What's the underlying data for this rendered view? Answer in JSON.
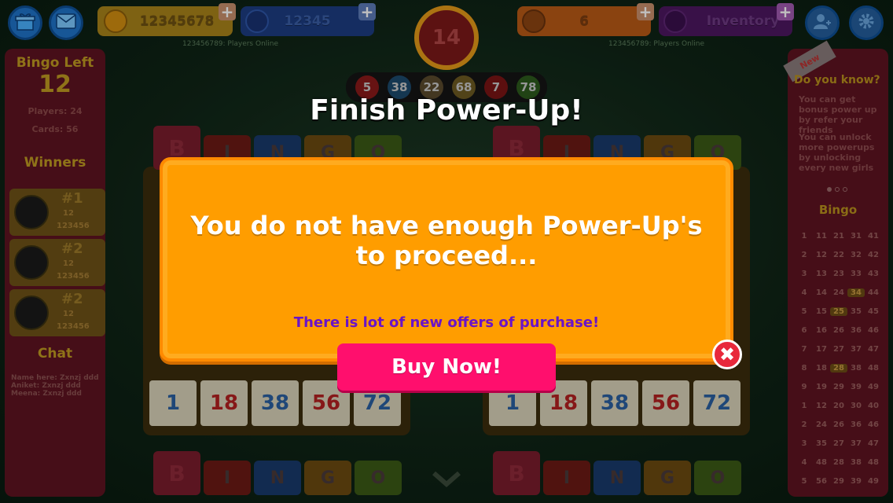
{
  "topbar": {
    "coins": "12345678",
    "energy": "12345",
    "left_online": "123456789: Players Online",
    "timer": "14",
    "powerups": "6",
    "inventory_label": "Inventory",
    "right_online": "123456789: Players Online",
    "plus_symbol": "+"
  },
  "called_balls": [
    {
      "value": "5",
      "color": "#8a1a1a"
    },
    {
      "value": "38",
      "color": "#1c4a6d"
    },
    {
      "value": "22",
      "color": "#5a4a2d"
    },
    {
      "value": "68",
      "color": "#6d5a22"
    },
    {
      "value": "7",
      "color": "#7a1515"
    },
    {
      "value": "78",
      "color": "#2d5a1c"
    }
  ],
  "left_panel": {
    "bingo_left_label": "Bingo Left",
    "bingo_left_value": "12",
    "players": "Players: 24",
    "cards": "Cards: 56",
    "winners_label": "Winners",
    "winners": [
      {
        "rank": "#1",
        "score": "12",
        "coins": "123456"
      },
      {
        "rank": "#2",
        "score": "12",
        "coins": "123456"
      },
      {
        "rank": "#2",
        "score": "12",
        "coins": "123456"
      }
    ],
    "chat_label": "Chat",
    "chat_lines": [
      "Name here: Zxnzj ddd",
      "Aniket: Zxnzj ddd",
      "Meena: Zxnzj ddd"
    ]
  },
  "right_panel": {
    "new_badge": "New",
    "did_you_know": "Do you know?",
    "tips": [
      "You can get bonus power up by refer your friends",
      "You can unlock more powerups by unlocking every new girls"
    ],
    "bingo_label": "Bingo",
    "grid": [
      [
        "1",
        "11",
        "21",
        "31",
        "41"
      ],
      [
        "2",
        "12",
        "22",
        "32",
        "42"
      ],
      [
        "3",
        "13",
        "23",
        "33",
        "43"
      ],
      [
        "4",
        "14",
        "24",
        "34",
        "44"
      ],
      [
        "5",
        "15",
        "25",
        "35",
        "45"
      ],
      [
        "6",
        "16",
        "26",
        "36",
        "46"
      ],
      [
        "7",
        "17",
        "27",
        "37",
        "47"
      ],
      [
        "8",
        "18",
        "28",
        "38",
        "48"
      ],
      [
        "9",
        "19",
        "29",
        "39",
        "49"
      ],
      [
        "1",
        "12",
        "20",
        "30",
        "40"
      ],
      [
        "2",
        "24",
        "26",
        "36",
        "46"
      ],
      [
        "3",
        "35",
        "27",
        "37",
        "47"
      ],
      [
        "4",
        "48",
        "28",
        "38",
        "48"
      ],
      [
        "5",
        "56",
        "29",
        "39",
        "49"
      ]
    ],
    "highlighted": [
      [
        3,
        3
      ],
      [
        4,
        2
      ],
      [
        7,
        2
      ]
    ]
  },
  "cards": {
    "letters": [
      "B",
      "I",
      "N",
      "G",
      "O"
    ],
    "bottom_row": [
      "1",
      "18",
      "38",
      "56",
      "72"
    ],
    "bottom_colors": [
      "#2a5fa0",
      "#b32020",
      "#2a5fa0",
      "#b32020",
      "#2a5fa0"
    ]
  },
  "modal": {
    "title": "Finish Power-Up!",
    "message_line1": "You do not have enough Power-Up's",
    "message_line2": "to proceed...",
    "subtext": "There is lot of new offers of purchase!",
    "buy_label": "Buy Now!",
    "close_symbol": "✖"
  }
}
